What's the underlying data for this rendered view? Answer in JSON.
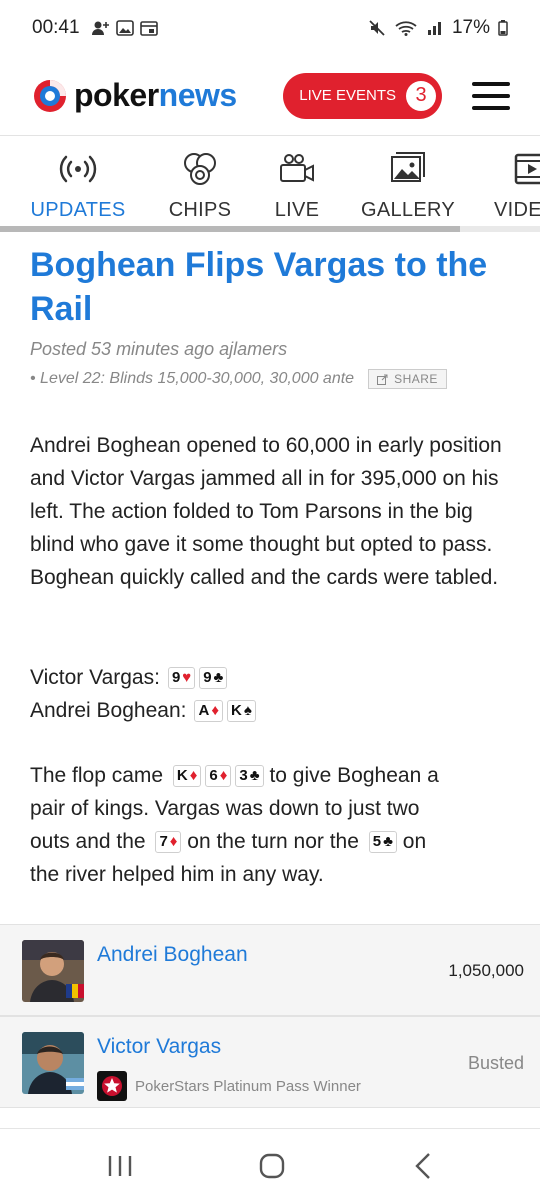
{
  "status_bar": {
    "time": "00:41",
    "battery": "17%"
  },
  "header": {
    "logo_poker": "poker",
    "logo_news": "news",
    "live_events_label": "LIVE EVENTS",
    "live_events_count": "3",
    "accent_color": "#1f7ad8",
    "live_color": "#e0212e"
  },
  "tabs": [
    {
      "label": "UPDATES",
      "icon": "broadcast-icon",
      "active": true
    },
    {
      "label": "CHIPS",
      "icon": "chips-icon",
      "active": false
    },
    {
      "label": "LIVE",
      "icon": "video-camera-icon",
      "active": false
    },
    {
      "label": "GALLERY",
      "icon": "gallery-icon",
      "active": false
    },
    {
      "label": "VIDE",
      "icon": "film-icon",
      "active": false
    }
  ],
  "article": {
    "headline": "Boghean Flips Vargas to the Rail",
    "posted": "Posted 53 minutes ago",
    "author": "ajlamers",
    "level": "• Level 22: Blinds 15,000-30,000, 30,000 ante",
    "share_label": "SHARE",
    "paragraph1": "Andrei Boghean opened to 60,000 in early position and Victor Vargas jammed all in for 395,000 on his left. The action folded to Tom Parsons in the big blind who gave it some thought but opted to pass. Boghean quickly called and the cards were tabled.",
    "hand1_label": "Victor Vargas:",
    "hand1_cards": [
      {
        "rank": "9",
        "suit": "♥",
        "color": "red"
      },
      {
        "rank": "9",
        "suit": "♣",
        "color": "black"
      }
    ],
    "hand2_label": "Andrei Boghean:",
    "hand2_cards": [
      {
        "rank": "A",
        "suit": "♦",
        "color": "red"
      },
      {
        "rank": "K",
        "suit": "♠",
        "color": "black"
      }
    ],
    "flop_prefix": "The flop came",
    "flop_cards": [
      {
        "rank": "K",
        "suit": "♦",
        "color": "red"
      },
      {
        "rank": "6",
        "suit": "♦",
        "color": "red"
      },
      {
        "rank": "3",
        "suit": "♣",
        "color": "black"
      }
    ],
    "flop_suffix": "to give Boghean a",
    "line2": "pair of kings. Vargas was down to just two",
    "line3_prefix": "outs and the",
    "turn_card": {
      "rank": "7",
      "suit": "♦",
      "color": "red"
    },
    "line3_middle": "on the turn nor the",
    "river_card": {
      "rank": "5",
      "suit": "♣",
      "color": "black"
    },
    "line3_suffix": "on",
    "line4": "the river helped him in any way."
  },
  "players": [
    {
      "name": "Andrei Boghean",
      "value": "1,050,000",
      "status": "",
      "badge": ""
    },
    {
      "name": "Victor Vargas",
      "value": "",
      "status": "Busted",
      "badge": "PokerStars Platinum Pass Winner"
    }
  ]
}
